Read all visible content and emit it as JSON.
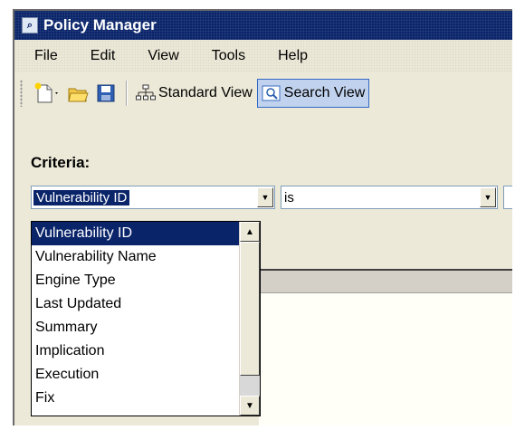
{
  "window": {
    "title": "Policy Manager"
  },
  "menu": {
    "items": [
      "File",
      "Edit",
      "View",
      "Tools",
      "Help"
    ]
  },
  "toolbar": {
    "standard_view_label": "Standard View",
    "search_view_label": "Search View"
  },
  "criteria": {
    "label": "Criteria:",
    "field_value": "Vulnerability ID",
    "operator_value": "is"
  },
  "dropdown": {
    "options": [
      "Vulnerability ID",
      "Vulnerability Name",
      "Engine Type",
      "Last Updated",
      "Summary",
      "Implication",
      "Execution",
      "Fix"
    ],
    "selected_index": 0
  },
  "colors": {
    "titlebar": "#0a246a",
    "selection": "#0a246a",
    "active_button": "#c1d2ee"
  }
}
